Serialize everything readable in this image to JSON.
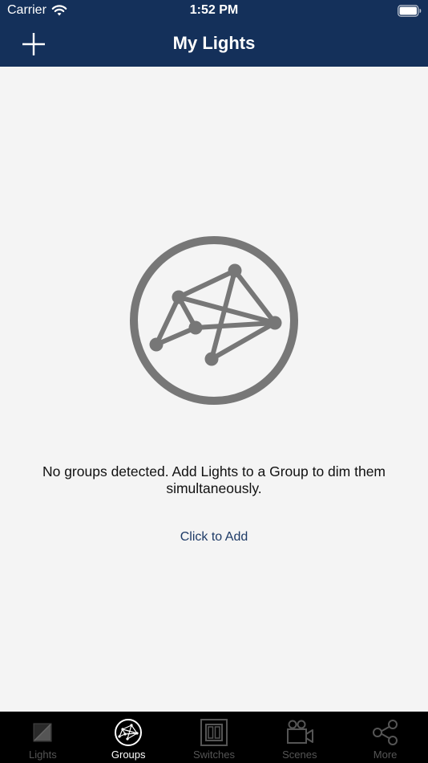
{
  "status_bar": {
    "carrier": "Carrier",
    "time": "1:52 PM",
    "wifi_icon": "wifi-icon",
    "battery_icon": "battery-icon"
  },
  "header": {
    "title": "My Lights",
    "add_icon": "plus-icon",
    "background_color": "#14305a"
  },
  "empty_state": {
    "icon": "network-group-icon",
    "message": "No groups detected. Add Lights to a Group to dim them simultaneously.",
    "action_label": "Click to Add"
  },
  "tab_bar": {
    "active_tab": "Groups",
    "tabs": [
      {
        "label": "Lights",
        "icon": "light-square-icon"
      },
      {
        "label": "Groups",
        "icon": "group-network-icon"
      },
      {
        "label": "Switches",
        "icon": "switch-icon"
      },
      {
        "label": "Scenes",
        "icon": "scene-camera-icon"
      },
      {
        "label": "More",
        "icon": "share-nodes-icon"
      }
    ]
  },
  "colors": {
    "accent": "#14305a",
    "link": "#1d3a66",
    "background": "#f4f4f4",
    "icon_gray": "#777777"
  }
}
